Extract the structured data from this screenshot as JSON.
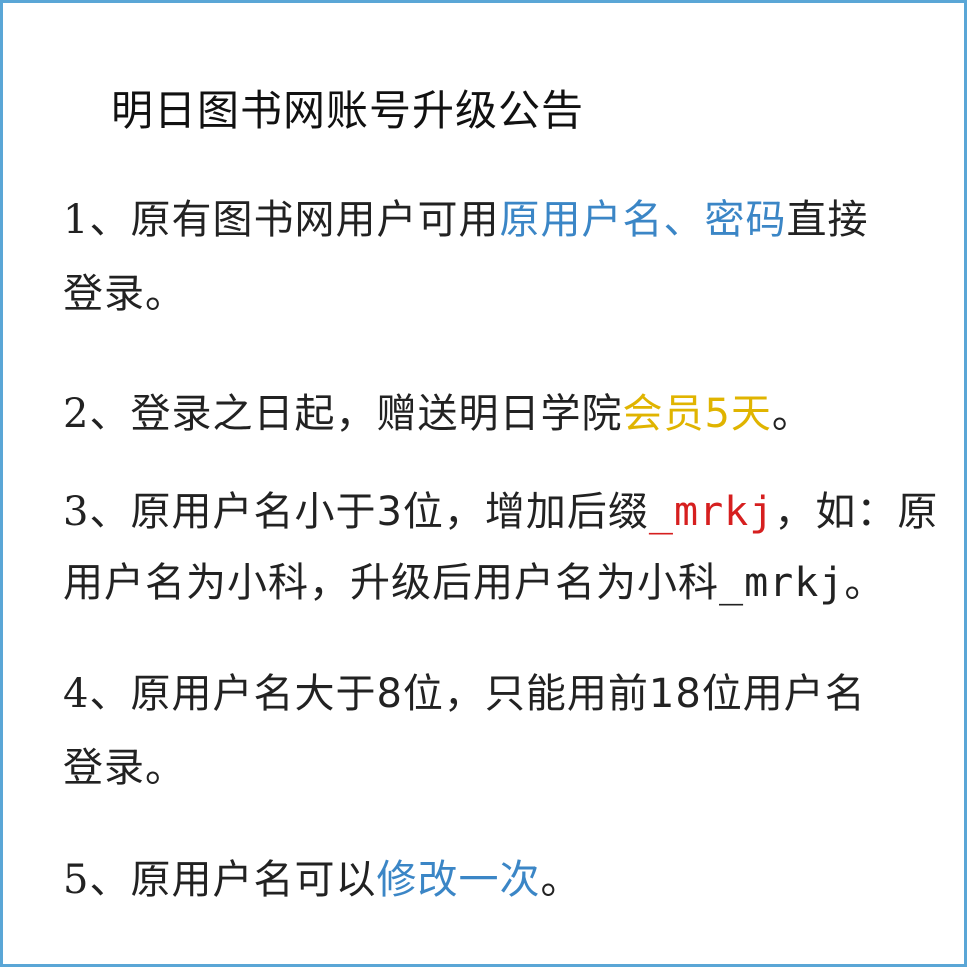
{
  "title": "明日图书网账号升级公告",
  "items": [
    {
      "n": "1、",
      "t1": "原有图书网用户可用",
      "h1": "原用户名、密码",
      "t2": "直接",
      "t3": "登录。"
    },
    {
      "n": "2、",
      "t1": "登录之日起，赠送明日学院",
      "h1": "会员5天",
      "t2": "。"
    },
    {
      "n": "3、",
      "t1": "原用户名小于3位，增加后缀",
      "h1": "_mrkj",
      "t2": "，如：原",
      "t3": "用户名为小科，升级后用户名为小科",
      "t4": "_mrkj",
      "t5": "。"
    },
    {
      "n": "4、",
      "t1": "原用户名大于8位，只能用前18位用户名",
      "t3": "登录。"
    },
    {
      "n": "5、",
      "t1": "原用户名可以",
      "h1": "修改一次",
      "t2": "。"
    }
  ],
  "colors": {
    "border": "#5aa6d6",
    "link_blue": "#3b86c6",
    "highlight_gold": "#e0b400",
    "suffix_red": "#d61f1f"
  }
}
